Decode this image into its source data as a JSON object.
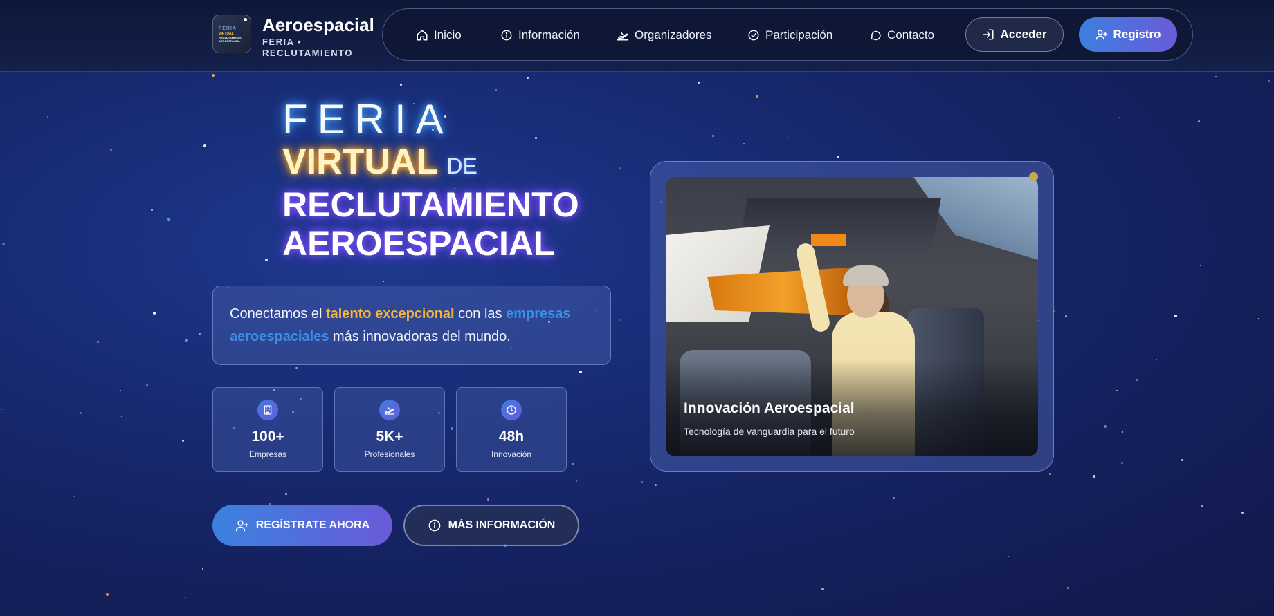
{
  "brand": {
    "title": "Aeroespacial",
    "subtitle": "FERIA • RECLUTAMIENTO",
    "logo_text": [
      "FERIA",
      "VIRTUAL",
      "RECLUTAMIENTO",
      "AEROESPACIAL"
    ]
  },
  "nav": {
    "items": [
      {
        "label": "Inicio",
        "icon": "home-icon"
      },
      {
        "label": "Información",
        "icon": "info-icon"
      },
      {
        "label": "Organizadores",
        "icon": "plane-takeoff-icon"
      },
      {
        "label": "Participación",
        "icon": "check-circle-icon"
      },
      {
        "label": "Contacto",
        "icon": "chat-icon"
      }
    ],
    "login_label": "Acceder",
    "register_label": "Registro"
  },
  "hero": {
    "line1": "FERIA",
    "line2a": "VIRTUAL",
    "line2b": "DE",
    "line3": "RECLUTAMIENTO",
    "line4": "AEROESPACIAL"
  },
  "intro": {
    "part1": "Conectamos el ",
    "highlight1": "talento excepcional",
    "part2": " con las ",
    "highlight2": "empresas aeroespaciales",
    "part3": " más innovadoras del mundo."
  },
  "stats": [
    {
      "value": "100+",
      "label": "Empresas",
      "icon": "building-icon"
    },
    {
      "value": "5K+",
      "label": "Profesionales",
      "icon": "plane-takeoff-icon"
    },
    {
      "value": "48h",
      "label": "Innovación",
      "icon": "clock-icon"
    }
  ],
  "cta": {
    "primary": "REGÍSTRATE AHORA",
    "secondary": "MÁS INFORMACIÓN"
  },
  "feature_card": {
    "title": "Innovación Aeroespacial",
    "subtitle": "Tecnología de vanguardia para el futuro"
  },
  "colors": {
    "accent_gold": "#f2b43a",
    "accent_blue": "#3a8fe4",
    "button_gradient_start": "#3d7fe0",
    "button_gradient_end": "#6a5bd8"
  }
}
